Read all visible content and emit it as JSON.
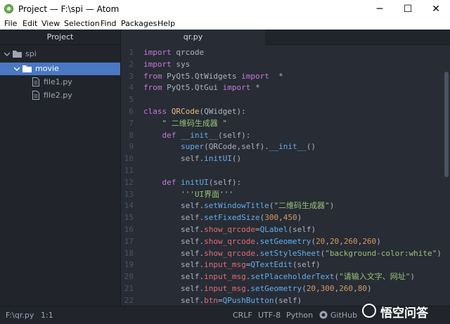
{
  "window": {
    "title": "Project — F:\\spi — Atom",
    "minimize": "─",
    "maximize": "☐",
    "close": "✕"
  },
  "menu": [
    "File",
    "Edit",
    "View",
    "Selection",
    "Find",
    "Packages",
    "Help"
  ],
  "tree": {
    "header": "Project",
    "items": [
      {
        "label": "spi",
        "type": "folder",
        "expanded": true,
        "depth": 0,
        "selected": false
      },
      {
        "label": "movie",
        "type": "folder",
        "expanded": true,
        "depth": 1,
        "selected": true
      },
      {
        "label": "file1.py",
        "type": "file",
        "depth": 2,
        "selected": false
      },
      {
        "label": "file2.py",
        "type": "file",
        "depth": 2,
        "selected": false
      }
    ]
  },
  "tab": {
    "label": "qr.py"
  },
  "code_lines": [
    [
      [
        "import",
        "kw"
      ],
      [
        " qrcode",
        ""
      ]
    ],
    [
      [
        "import",
        "kw"
      ],
      [
        " sys",
        ""
      ]
    ],
    [
      [
        "from",
        "kw"
      ],
      [
        " PyQt5.QtWidgets ",
        ""
      ],
      [
        "import",
        "kw"
      ],
      [
        "  *",
        ""
      ]
    ],
    [
      [
        "from",
        "kw"
      ],
      [
        " PyQt5.QtGui ",
        ""
      ],
      [
        "import",
        "kw"
      ],
      [
        " *",
        ""
      ]
    ],
    [],
    [
      [
        "class",
        "kw"
      ],
      [
        " ",
        ""
      ],
      [
        "QRCode",
        "cls"
      ],
      [
        "(QWidget):",
        ""
      ]
    ],
    [
      [
        "    \" 二维码生成器 \"",
        "str"
      ]
    ],
    [
      [
        "    ",
        ""
      ],
      [
        "def",
        "kw"
      ],
      [
        " ",
        ""
      ],
      [
        "__init__",
        "fn"
      ],
      [
        "(self):",
        ""
      ]
    ],
    [
      [
        "        ",
        ""
      ],
      [
        "super",
        "fn"
      ],
      [
        "(QRCode,self).",
        ""
      ],
      [
        "__init__",
        "fn"
      ],
      [
        "()",
        ""
      ]
    ],
    [
      [
        "        self.",
        ""
      ],
      [
        "initUI",
        "fn"
      ],
      [
        "()",
        ""
      ]
    ],
    [],
    [
      [
        "    ",
        ""
      ],
      [
        "def",
        "kw"
      ],
      [
        " ",
        ""
      ],
      [
        "initUI",
        "fn"
      ],
      [
        "(self):",
        ""
      ]
    ],
    [
      [
        "        '''UI界面'''",
        "str"
      ]
    ],
    [
      [
        "        self.",
        ""
      ],
      [
        "setWindowTitle",
        "fn"
      ],
      [
        "(",
        ""
      ],
      [
        "\"二维码生成器\"",
        "str"
      ],
      [
        ")",
        ""
      ]
    ],
    [
      [
        "        self.",
        ""
      ],
      [
        "setFixedSize",
        "fn"
      ],
      [
        "(",
        ""
      ],
      [
        "300",
        "num"
      ],
      [
        ",",
        ""
      ],
      [
        "450",
        "num"
      ],
      [
        ")",
        ""
      ]
    ],
    [
      [
        "        self.",
        ""
      ],
      [
        "show_qrcode",
        "sf"
      ],
      [
        "=",
        ""
      ],
      [
        "QLabel",
        "fn"
      ],
      [
        "(self)",
        ""
      ]
    ],
    [
      [
        "        self.",
        ""
      ],
      [
        "show_qrcode",
        "sf"
      ],
      [
        ".",
        ""
      ],
      [
        "setGeometry",
        "fn"
      ],
      [
        "(",
        ""
      ],
      [
        "20",
        "num"
      ],
      [
        ",",
        ""
      ],
      [
        "20",
        "num"
      ],
      [
        ",",
        ""
      ],
      [
        "260",
        "num"
      ],
      [
        ",",
        ""
      ],
      [
        "260",
        "num"
      ],
      [
        ")",
        ""
      ]
    ],
    [
      [
        "        self.",
        ""
      ],
      [
        "show_qrcode",
        "sf"
      ],
      [
        ".",
        ""
      ],
      [
        "setStyleSheet",
        "fn"
      ],
      [
        "(",
        ""
      ],
      [
        "\"background-color:white\"",
        "str"
      ],
      [
        ")",
        ""
      ]
    ],
    [
      [
        "        self.",
        ""
      ],
      [
        "input_msg",
        "sf"
      ],
      [
        "=",
        ""
      ],
      [
        "QTextEdit",
        "fn"
      ],
      [
        "(self)",
        ""
      ]
    ],
    [
      [
        "        self.",
        ""
      ],
      [
        "input_msg",
        "sf"
      ],
      [
        ".",
        ""
      ],
      [
        "setPlaceholderText",
        "fn"
      ],
      [
        "(",
        ""
      ],
      [
        "\"请输入文字、网址\"",
        "str"
      ],
      [
        ")",
        ""
      ]
    ],
    [
      [
        "        self.",
        ""
      ],
      [
        "input_msg",
        "sf"
      ],
      [
        ".",
        ""
      ],
      [
        "setGeometry",
        "fn"
      ],
      [
        "(",
        ""
      ],
      [
        "20",
        "num"
      ],
      [
        ",",
        ""
      ],
      [
        "300",
        "num"
      ],
      [
        ",",
        ""
      ],
      [
        "260",
        "num"
      ],
      [
        ",",
        ""
      ],
      [
        "80",
        "num"
      ],
      [
        ")",
        ""
      ]
    ],
    [
      [
        "        self.",
        ""
      ],
      [
        "btn",
        "sf"
      ],
      [
        "=",
        ""
      ],
      [
        "QPushButton",
        "fn"
      ],
      [
        "(self)",
        ""
      ]
    ]
  ],
  "status": {
    "file": "F:\\qr.py",
    "cursor": "1:1",
    "line_ending": "CRLF",
    "encoding": "UTF-8",
    "grammar": "Python",
    "github": "GitHub"
  },
  "watermark": "悟空问答",
  "colors": {
    "selection": "#4a78c2",
    "keyword": "#c678dd",
    "function": "#61afef",
    "string": "#98c379",
    "number": "#d19a66"
  }
}
